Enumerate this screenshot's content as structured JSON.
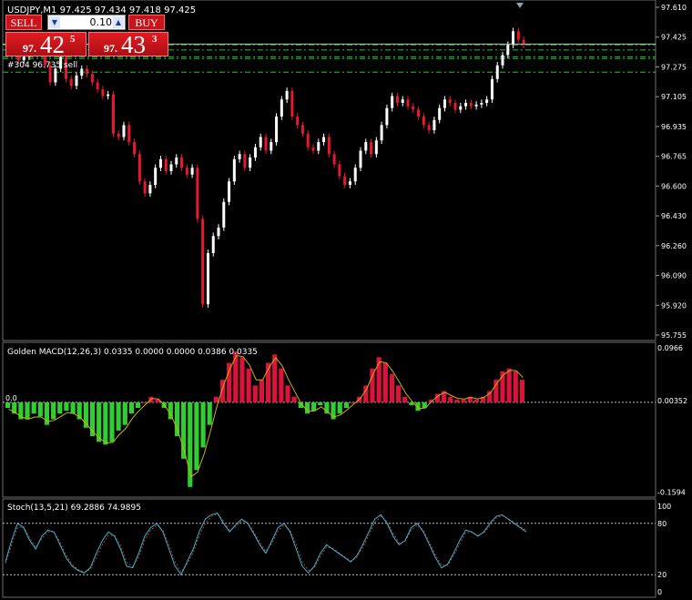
{
  "header": {
    "symbol_line": "USDJPY,M1  97.425 97.434 97.418 97.425",
    "order_label": "#304 96.735 sell"
  },
  "trade_panel": {
    "sell_label": "SELL",
    "buy_label": "BUY",
    "lot": "0.10",
    "sell_small": "97.",
    "sell_big": "42",
    "sell_sup": "5",
    "buy_small": "97.",
    "buy_big": "43",
    "buy_sup": "3"
  },
  "colors": {
    "bull": "#ffffff",
    "bear": "#e8182e",
    "macd_pos": "#dc143c",
    "macd_neg": "#32cd32",
    "macd_line": "#c8b400",
    "stoch_main": "#3cb4d2",
    "stoch_signal": "#b43c3c",
    "levels": "#22c522",
    "axis_text": "#ffffff"
  },
  "chart_data": [
    {
      "type": "candlestick",
      "name": "USDJPY,M1",
      "ylim": [
        95.72,
        97.64
      ],
      "y_ticks": [
        "97.610",
        "97.425",
        "97.275",
        "97.105",
        "96.935",
        "96.765",
        "96.600",
        "96.430",
        "96.260",
        "96.090",
        "95.920",
        "95.755"
      ],
      "current_price": "97.425",
      "levels": [
        97.42,
        97.39,
        97.35,
        97.34,
        97.26
      ],
      "closes": [
        97.4,
        97.38,
        97.33,
        97.35,
        97.39,
        97.42,
        97.4,
        97.3,
        97.2,
        97.28,
        97.35,
        97.22,
        97.18,
        97.24,
        97.28,
        97.25,
        97.2,
        97.16,
        97.12,
        97.13,
        96.9,
        96.88,
        96.95,
        96.85,
        96.78,
        96.62,
        96.55,
        96.6,
        96.7,
        96.75,
        96.68,
        96.72,
        96.76,
        96.7,
        96.66,
        96.7,
        96.4,
        95.9,
        96.2,
        96.3,
        96.35,
        96.5,
        96.62,
        96.75,
        96.78,
        96.7,
        96.76,
        96.82,
        96.88,
        96.8,
        96.85,
        97.0,
        97.1,
        97.15,
        97.0,
        96.95,
        96.9,
        96.82,
        96.8,
        96.85,
        96.88,
        96.78,
        96.72,
        96.65,
        96.6,
        96.62,
        96.7,
        96.8,
        96.85,
        96.78,
        96.86,
        96.95,
        97.05,
        97.12,
        97.08,
        97.1,
        97.06,
        97.04,
        97.0,
        96.95,
        96.92,
        96.98,
        97.05,
        97.1,
        97.08,
        97.04,
        97.06,
        97.08,
        97.06,
        97.07,
        97.08,
        97.1,
        97.22,
        97.3,
        97.36,
        97.42,
        97.5,
        97.45,
        97.42
      ],
      "current_price_value": 97.425,
      "down_arrow": true
    },
    {
      "type": "histogram",
      "name": "Golden MACD(12,26,3)",
      "label": "Golden MACD(12,26,3) 0.0335 0.0000 0.0000 0.0386 0.0335",
      "ylim": [
        -0.16,
        0.1
      ],
      "y_ticks": [
        "0.0966",
        "0.00352",
        "-0.1594"
      ],
      "left_label": "0.0",
      "values": [
        -0.01,
        -0.02,
        -0.03,
        -0.03,
        -0.02,
        -0.025,
        -0.04,
        -0.03,
        -0.02,
        -0.015,
        -0.02,
        -0.03,
        -0.045,
        -0.06,
        -0.07,
        -0.075,
        -0.07,
        -0.05,
        -0.04,
        -0.02,
        -0.01,
        0.0,
        0.01,
        0.005,
        -0.01,
        -0.03,
        -0.06,
        -0.1,
        -0.15,
        -0.12,
        -0.08,
        -0.04,
        0.01,
        0.04,
        0.07,
        0.09,
        0.08,
        0.06,
        0.03,
        0.04,
        0.07,
        0.085,
        0.06,
        0.03,
        0.01,
        -0.01,
        -0.02,
        -0.015,
        -0.005,
        -0.02,
        -0.03,
        -0.02,
        -0.01,
        0.0,
        0.01,
        0.03,
        0.06,
        0.08,
        0.07,
        0.05,
        0.03,
        0.01,
        -0.005,
        -0.015,
        -0.01,
        0.005,
        0.015,
        0.02,
        0.01,
        0.005,
        0.005,
        0.01,
        0.005,
        0.01,
        0.02,
        0.04,
        0.055,
        0.06,
        0.055,
        0.04
      ],
      "signal": [
        -0.012,
        -0.018,
        -0.026,
        -0.03,
        -0.026,
        -0.026,
        -0.034,
        -0.032,
        -0.025,
        -0.018,
        -0.02,
        -0.027,
        -0.039,
        -0.053,
        -0.064,
        -0.072,
        -0.071,
        -0.057,
        -0.046,
        -0.028,
        -0.015,
        -0.004,
        0.007,
        0.006,
        -0.006,
        -0.024,
        -0.051,
        -0.087,
        -0.132,
        -0.124,
        -0.092,
        -0.051,
        -0.006,
        0.03,
        0.06,
        0.083,
        0.081,
        0.066,
        0.04,
        0.04,
        0.062,
        0.079,
        0.065,
        0.04,
        0.018,
        -0.004,
        -0.016,
        -0.015,
        -0.008,
        -0.017,
        -0.026,
        -0.022,
        -0.013,
        -0.003,
        0.007,
        0.024,
        0.051,
        0.072,
        0.07,
        0.055,
        0.036,
        0.016,
        0.001,
        -0.011,
        -0.01,
        0.002,
        0.012,
        0.018,
        0.012,
        0.007,
        0.006,
        0.009,
        0.006,
        0.009,
        0.017,
        0.034,
        0.049,
        0.057,
        0.056,
        0.044
      ]
    },
    {
      "type": "line",
      "name": "Stoch(13,5,21)",
      "label": "Stoch(13,5,21) 69.2886 74.9895",
      "ylim": [
        0,
        100
      ],
      "y_ticks": [
        "100",
        "80",
        "20",
        "0"
      ],
      "levels": [
        80,
        20
      ],
      "main": [
        35,
        60,
        80,
        75,
        60,
        50,
        65,
        72,
        70,
        55,
        40,
        30,
        25,
        22,
        28,
        45,
        60,
        70,
        65,
        50,
        30,
        28,
        45,
        65,
        75,
        80,
        70,
        50,
        30,
        20,
        35,
        50,
        70,
        85,
        90,
        92,
        80,
        70,
        78,
        85,
        80,
        68,
        55,
        45,
        60,
        75,
        80,
        70,
        50,
        30,
        22,
        30,
        45,
        55,
        50,
        45,
        40,
        35,
        42,
        55,
        70,
        85,
        90,
        80,
        65,
        55,
        60,
        75,
        80,
        70,
        55,
        40,
        28,
        32,
        45,
        60,
        72,
        70,
        65,
        70,
        80,
        88,
        90,
        85,
        80,
        75,
        70
      ],
      "signal": [
        33,
        55,
        75,
        76,
        63,
        52,
        62,
        70,
        70,
        58,
        43,
        32,
        26,
        23,
        26,
        40,
        55,
        66,
        66,
        54,
        35,
        29,
        41,
        60,
        72,
        78,
        72,
        55,
        35,
        23,
        32,
        46,
        65,
        80,
        88,
        91,
        83,
        72,
        76,
        83,
        81,
        70,
        58,
        47,
        57,
        71,
        78,
        72,
        55,
        35,
        25,
        28,
        41,
        52,
        51,
        46,
        41,
        36,
        40,
        52,
        66,
        81,
        88,
        82,
        68,
        57,
        59,
        72,
        78,
        72,
        58,
        43,
        31,
        31,
        42,
        56,
        69,
        70,
        66,
        69,
        77,
        86,
        89,
        86,
        81,
        76,
        72
      ]
    }
  ]
}
